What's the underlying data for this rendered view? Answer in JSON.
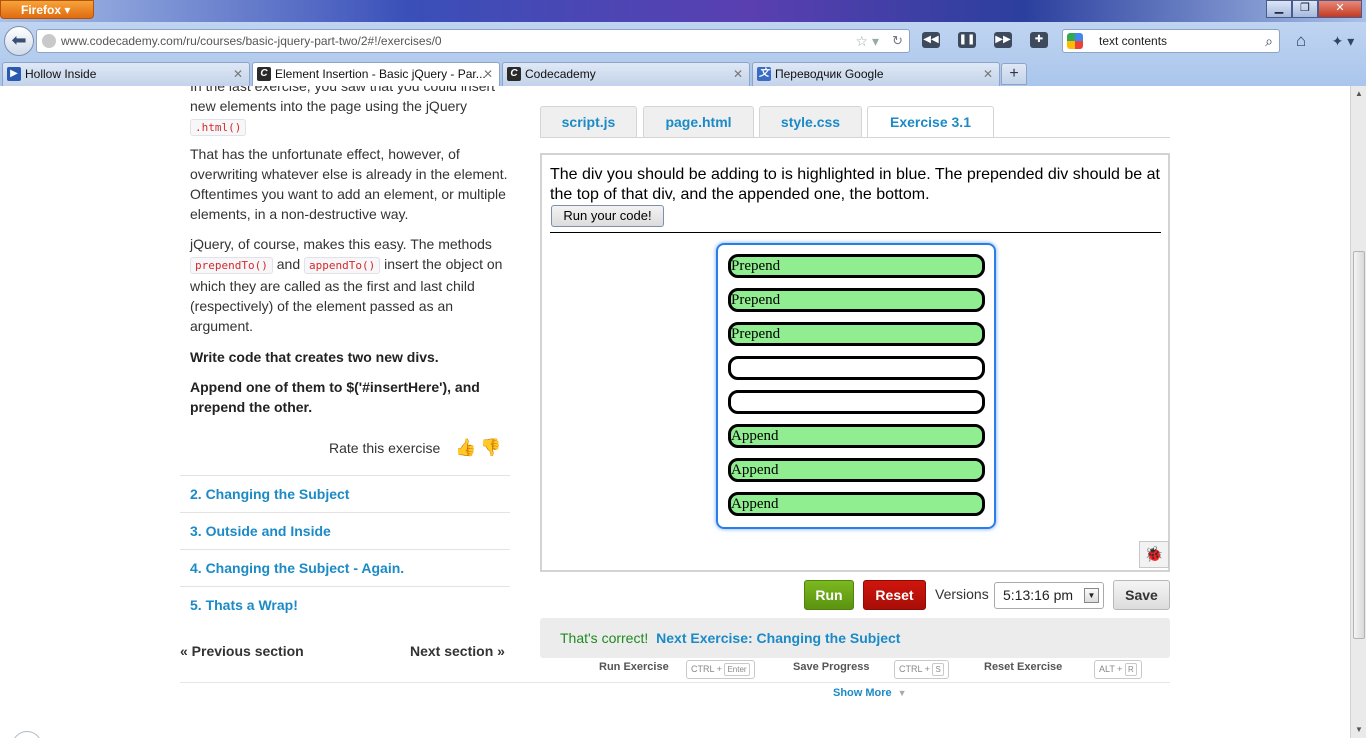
{
  "browser": {
    "menu_button": "Firefox",
    "url": "www.codecademy.com/ru/courses/basic-jquery-part-two/2#!/exercises/0",
    "search_text": "text contents",
    "tabs": [
      {
        "label": "Hollow Inside",
        "active": false
      },
      {
        "label": "Element Insertion - Basic jQuery - Par...",
        "active": true
      },
      {
        "label": "Codecademy",
        "active": false
      },
      {
        "label": "Переводчик Google",
        "active": false
      }
    ],
    "newtab_label": "+",
    "icons": [
      "back-icon",
      "globe-icon",
      "star-icon",
      "reload-icon",
      "rewind-icon",
      "pause-icon",
      "forward-icon",
      "plus-icon",
      "google-icon",
      "search-icon",
      "home-icon",
      "bookmarks-icon"
    ]
  },
  "lesson": {
    "intro_cutoff": "In the last exercise, you saw that you could insert new elements into the page using the jQuery",
    "code_html": ".html()",
    "para2": "That has the unfortunate effect, however, of overwriting whatever else is already in the element. Oftentimes you want to add an element, or multiple elements, in a non-destructive way.",
    "para3_a": "jQuery, of course, makes this easy. The methods",
    "code_prepend": "prependTo()",
    "para3_and": "and",
    "code_append": "appendTo()",
    "para3_b": "insert the object on which they are called as the first and last child (respectively) of the element passed as an argument.",
    "task1": "Write code that creates two new divs.",
    "task2": "Append one of them to $('#insertHere'), and prepend the other.",
    "rate_label": "Rate this exercise"
  },
  "lessons_nav": [
    "2. Changing the Subject",
    "3. Outside and Inside",
    "4. Changing the Subject - Again.",
    "5. Thats a Wrap!"
  ],
  "section_nav": {
    "prev": "« Previous section",
    "next": "Next section »"
  },
  "editor_tabs": [
    {
      "label": "script.js",
      "active": false
    },
    {
      "label": "page.html",
      "active": false
    },
    {
      "label": "style.css",
      "active": false
    },
    {
      "label": "Exercise 3.1",
      "active": true
    }
  ],
  "result": {
    "instructions": "The div you should be adding to is highlighted in blue. The prepended div should be at the top of that div, and the appended one, the bottom.",
    "run_your_code": "Run your code!",
    "divs": [
      "Prepend",
      "Prepend",
      "Prepend",
      "",
      "",
      "Append",
      "Append",
      "Append"
    ],
    "highlight_color": "#2b7de9",
    "div_color": "#90ee90"
  },
  "controls": {
    "run": "Run",
    "reset": "Reset",
    "versions_label": "Versions",
    "version_value": "5:13:16 pm",
    "save": "Save"
  },
  "feedback": {
    "correct": "That's correct!",
    "next_exercise": "Next Exercise: Changing the Subject"
  },
  "shortcuts": [
    {
      "label": "Run Exercise",
      "mod": "CTRL +",
      "key": "Enter"
    },
    {
      "label": "Save Progress",
      "mod": "CTRL +",
      "key": "S"
    },
    {
      "label": "Reset Exercise",
      "mod": "ALT +",
      "key": "R"
    }
  ],
  "show_more": "Show More",
  "colors": {
    "link": "#1b8ac6",
    "run": "#6aa417",
    "reset": "#c0120a",
    "correct": "#1e8a21"
  }
}
